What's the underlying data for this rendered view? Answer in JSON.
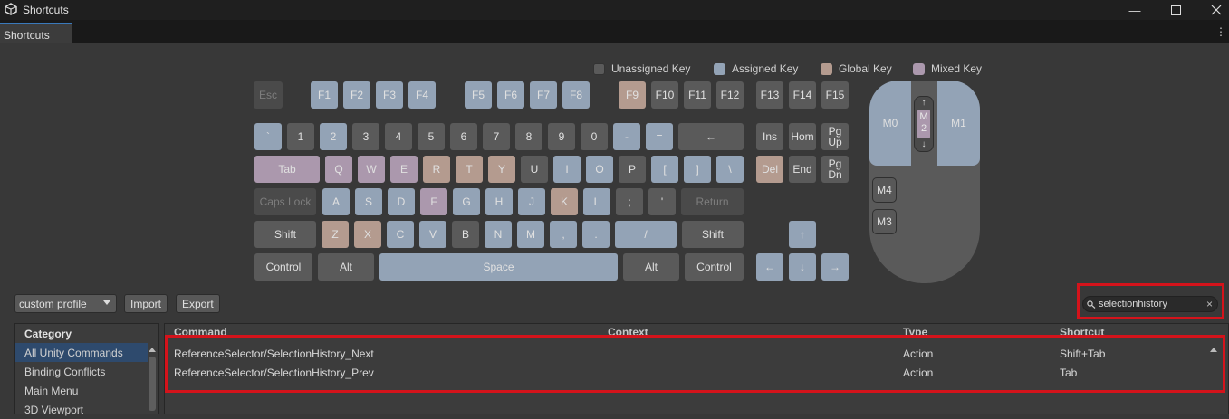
{
  "window": {
    "title": "Shortcuts",
    "tab": "Shortcuts"
  },
  "legend": [
    {
      "label": "Unassigned Key",
      "color": "#5a5a5a"
    },
    {
      "label": "Assigned Key",
      "color": "#93a3b6"
    },
    {
      "label": "Global Key",
      "color": "#b49b8f"
    },
    {
      "label": "Mixed Key",
      "color": "#ab98ad"
    }
  ],
  "keys": {
    "esc": "Esc",
    "f1": "F1",
    "f2": "F2",
    "f3": "F3",
    "f4": "F4",
    "f5": "F5",
    "f6": "F6",
    "f7": "F7",
    "f8": "F8",
    "f9": "F9",
    "f10": "F10",
    "f11": "F11",
    "f12": "F12",
    "f13": "F13",
    "f14": "F14",
    "f15": "F15",
    "backtick": "`",
    "n1": "1",
    "n2": "2",
    "n3": "3",
    "n4": "4",
    "n5": "5",
    "n6": "6",
    "n7": "7",
    "n8": "8",
    "n9": "9",
    "n0": "0",
    "minus": "-",
    "equals": "=",
    "backspace": "←",
    "ins": "Ins",
    "home": "Hom",
    "pgup": "Pg Up",
    "tab": "Tab",
    "q": "Q",
    "w": "W",
    "e": "E",
    "r": "R",
    "t": "T",
    "y": "Y",
    "u": "U",
    "i": "I",
    "o": "O",
    "p": "P",
    "lbracket": "[",
    "rbracket": "]",
    "backslash": "\\",
    "del": "Del",
    "end": "End",
    "pgdn": "Pg Dn",
    "capslock": "Caps Lock",
    "a": "A",
    "s": "S",
    "d": "D",
    "f": "F",
    "g": "G",
    "h": "H",
    "j": "J",
    "k": "K",
    "l": "L",
    "semicolon": ";",
    "quote": "'",
    "return": "Return",
    "lshift": "Shift",
    "z": "Z",
    "x": "X",
    "c": "C",
    "v": "V",
    "b": "B",
    "n": "N",
    "m": "M",
    "comma": ",",
    "period": ".",
    "slash": "/",
    "rshift": "Shift",
    "lcontrol": "Control",
    "lalt": "Alt",
    "space": "Space",
    "ralt": "Alt",
    "rcontrol": "Control",
    "up": "↑",
    "left": "←",
    "down": "↓",
    "right": "→"
  },
  "mouse": {
    "m0": "M0",
    "m1": "M1",
    "m2": "M 2",
    "m2_up": "↑",
    "m2_down": "↓",
    "m4": "M4",
    "m3": "M3"
  },
  "toolbar": {
    "profile": "custom profile",
    "import": "Import",
    "export": "Export",
    "search_value": "selectionhistory"
  },
  "category": {
    "header": "Category",
    "items": [
      "All Unity Commands",
      "Binding Conflicts",
      "Main Menu",
      "3D Viewport"
    ]
  },
  "commands": {
    "columns": {
      "command": "Command",
      "context": "Context",
      "type": "Type",
      "shortcut": "Shortcut"
    },
    "rows": [
      {
        "command": "ReferenceSelector/SelectionHistory_Next",
        "context": "",
        "type": "Action",
        "shortcut": "Shift+Tab"
      },
      {
        "command": "ReferenceSelector/SelectionHistory_Prev",
        "context": "",
        "type": "Action",
        "shortcut": "Tab"
      }
    ]
  }
}
